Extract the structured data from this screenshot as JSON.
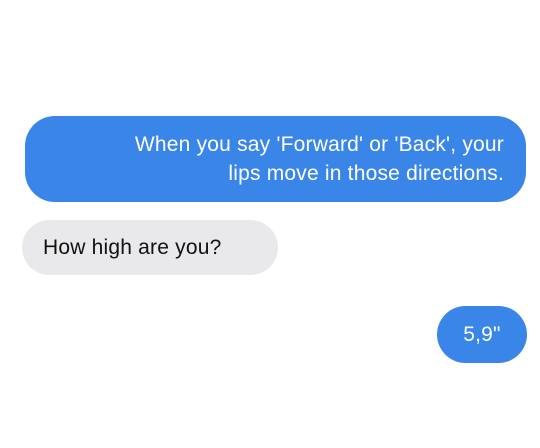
{
  "conversation": {
    "messages": [
      {
        "sender": "me",
        "text": "When you say 'Forward' or 'Back', your\nlips move in those directions."
      },
      {
        "sender": "them",
        "text": "How high are you?"
      },
      {
        "sender": "me",
        "text": "5,9\""
      }
    ]
  },
  "colors": {
    "outgoing_bubble": "#3a86e8",
    "outgoing_text": "#ffffff",
    "incoming_bubble": "#e9e9eb",
    "incoming_text": "#111111",
    "background": "#ffffff"
  }
}
